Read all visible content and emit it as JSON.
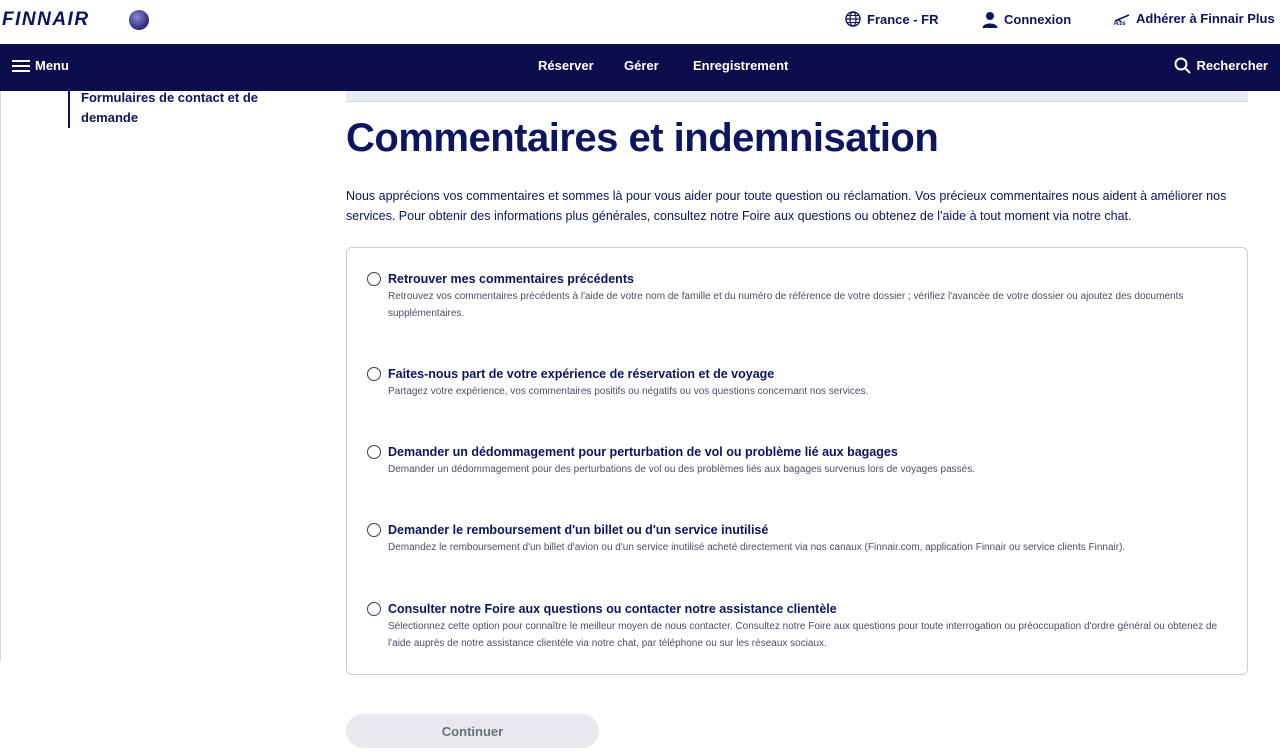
{
  "header": {
    "logo_text": "FINNAIR",
    "language": "France - FR",
    "login": "Connexion",
    "join_plus": "Adhérer à Finnair Plus"
  },
  "nav": {
    "menu": "Menu",
    "links": [
      "Réserver",
      "Gérer",
      "Enregistrement"
    ],
    "search": "Rechercher"
  },
  "sidebar": {
    "active_item": "Formulaires de contact et de demande"
  },
  "main": {
    "title": "Commentaires et indemnisation",
    "intro": "Nous apprécions vos commentaires et sommes là pour vous aider pour toute question ou réclamation. Vos précieux commentaires nous aident à améliorer nos services. Pour obtenir des informations plus générales, consultez notre Foire aux questions ou obtenez de l'aide à tout moment via notre chat.",
    "options": [
      {
        "title": "Retrouver mes commentaires précédents",
        "description": "Retrouvez vos commentaires précédents à l'aide de votre nom de famille et du numéro de référence de votre dossier ; vérifiez l'avancée de votre dossier ou ajoutez des documents supplémentaires."
      },
      {
        "title": "Faites-nous part de votre expérience de réservation et de voyage",
        "description": "Partagez votre expérience, vos commentaires positifs ou négatifs ou vos questions concernant nos services."
      },
      {
        "title": "Demander un dédommagement pour perturbation de vol ou problème lié aux bagages",
        "description": "Demander un dédommagement pour des perturbations de vol ou des problèmes liés aux bagages survenus lors de voyages passés."
      },
      {
        "title": "Demander le remboursement d'un billet ou d'un service inutilisé",
        "description": "Demandez le remboursement d'un billet d'avion ou d'un service inutilisé acheté directement via nos canaux (Finnair.com, application Finnair ou service clients Finnair)."
      },
      {
        "title": "Consulter notre Foire aux questions ou contacter notre assistance clientèle",
        "description": "Sélectionnez cette option pour connaître le meilleur moyen de nous contacter. Consultez notre Foire aux questions pour toute interrogation ou préoccupation d'ordre général ou obtenez de l'aide auprès de notre assistance clientèle via notre chat, par téléphone ou sur les réseaux sociaux."
      }
    ],
    "continue_label": "Continuer"
  },
  "colors": {
    "navy": "#0b0d4d",
    "text": "#0b1560",
    "button_disabled": "#e8e9ee"
  },
  "icons": [
    "globe-icon",
    "user-icon",
    "finnair-plus-icon",
    "hamburger-icon",
    "search-icon",
    "oneworld-badge-icon"
  ]
}
